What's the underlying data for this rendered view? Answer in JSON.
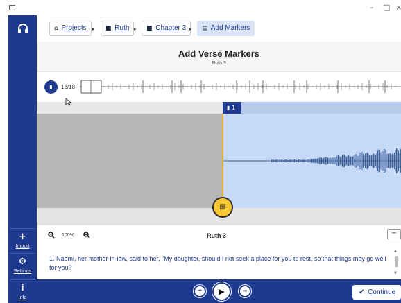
{
  "window": {
    "minimize_glyph": "–",
    "maximize_glyph": "□",
    "close_glyph": "×"
  },
  "sidebar": {
    "logo_icon": "headphones-icon",
    "items": [
      {
        "label": "Import",
        "glyph": "+",
        "icon": "plus-icon"
      },
      {
        "label": "Settings",
        "glyph": "⚙",
        "icon": "gear-icon"
      },
      {
        "label": "Info",
        "glyph": "i",
        "icon": "info-icon"
      }
    ]
  },
  "breadcrumbs": [
    {
      "label": "Projects",
      "glyph": "⌂",
      "icon": "home-icon"
    },
    {
      "label": "Ruth",
      "glyph": "■",
      "icon": "book-icon"
    },
    {
      "label": "Chapter 3",
      "glyph": "■",
      "icon": "file-icon"
    },
    {
      "label": "Add Markers",
      "glyph": "▤",
      "icon": "markers-icon",
      "active": true
    }
  ],
  "breadcrumb_separator": "▸",
  "header": {
    "title": "Add Verse Markers",
    "subtitle": "Ruth 3"
  },
  "overview": {
    "marker_glyph": "▮",
    "marker_count": "18/18"
  },
  "waveform": {
    "selection_fraction_start": 0.51,
    "verse_flag_glyph": "▮",
    "verse_flag_number": "1",
    "marker_handle_glyph": "▤"
  },
  "zoom": {
    "zoom_out_glyph": "−",
    "zoom_in_glyph": "+",
    "zoom_level": "100%",
    "chapter_label": "Ruth 3",
    "collapse_glyph": "−"
  },
  "verse": {
    "text": "1. Naomi, her mother-in-law, said to her, \"My daughter, should I not seek a place for you to rest, so that things may go well for you?"
  },
  "transport": {
    "prev_glyph": "⏮",
    "play_glyph": "▶",
    "next_glyph": "⏭"
  },
  "footer": {
    "continue_glyph": "✔",
    "continue_label": "Continue"
  },
  "colors": {
    "primary": "#1e3a8f",
    "selection": "#c6d9f6",
    "marker": "#f6c633"
  }
}
